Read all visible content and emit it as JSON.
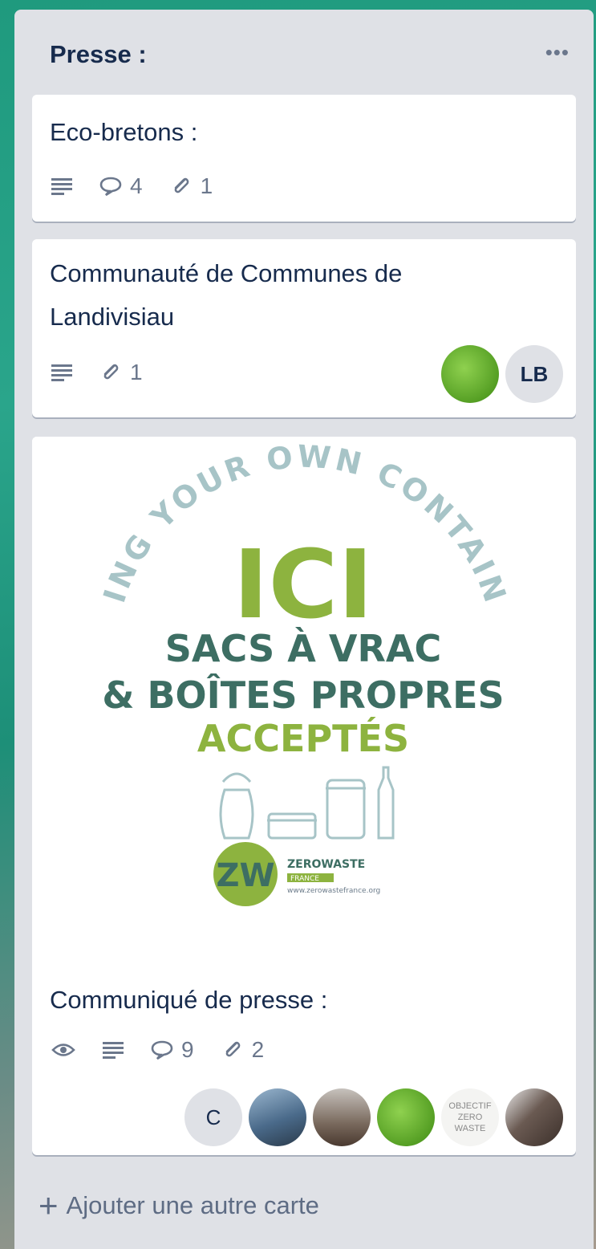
{
  "list": {
    "title": "Presse :",
    "menu_icon": "ellipsis-icon",
    "add_card_label": "Ajouter une autre carte"
  },
  "cards": [
    {
      "title_lines": [
        "Eco-bretons :"
      ],
      "badges": {
        "description": true,
        "comments": "4",
        "attachments": "1"
      }
    },
    {
      "title_lines": [
        "Communauté de Communes de",
        "Landivisiau"
      ],
      "badges": {
        "description": true,
        "attachments": "1"
      },
      "members": [
        {
          "type": "photo",
          "color": "#5aa520"
        },
        {
          "type": "initials",
          "text": "LB"
        }
      ]
    },
    {
      "title_lines": [
        "Communiqué de presse :"
      ],
      "cover": {
        "arc_text": "BRING YOUR OWN CONTAINER",
        "line1": "ICI",
        "line2": "SACS À VRAC",
        "line3": "& BOÎTES PROPRES",
        "line4": "ACCEPTÉS",
        "logo_mark": "ZW",
        "logo_name": "ZEROWASTE",
        "logo_sub": "FRANCE",
        "logo_url": "www.zerowastefrance.org",
        "colors": {
          "green": "#8db33f",
          "teal": "#3d6e63",
          "pale": "#a7c4c7"
        }
      },
      "badges": {
        "watching": true,
        "description": true,
        "comments": "9",
        "attachments": "2"
      },
      "members": [
        {
          "type": "initials",
          "text": "C"
        },
        {
          "type": "photo",
          "color": "#4a6a8a"
        },
        {
          "type": "photo",
          "color": "#7a6a5e"
        },
        {
          "type": "photo",
          "color": "#5aa520"
        },
        {
          "type": "text",
          "text": "OBJECTIF ZERO WASTE"
        },
        {
          "type": "photo",
          "color": "#3b2f2a"
        }
      ]
    }
  ]
}
